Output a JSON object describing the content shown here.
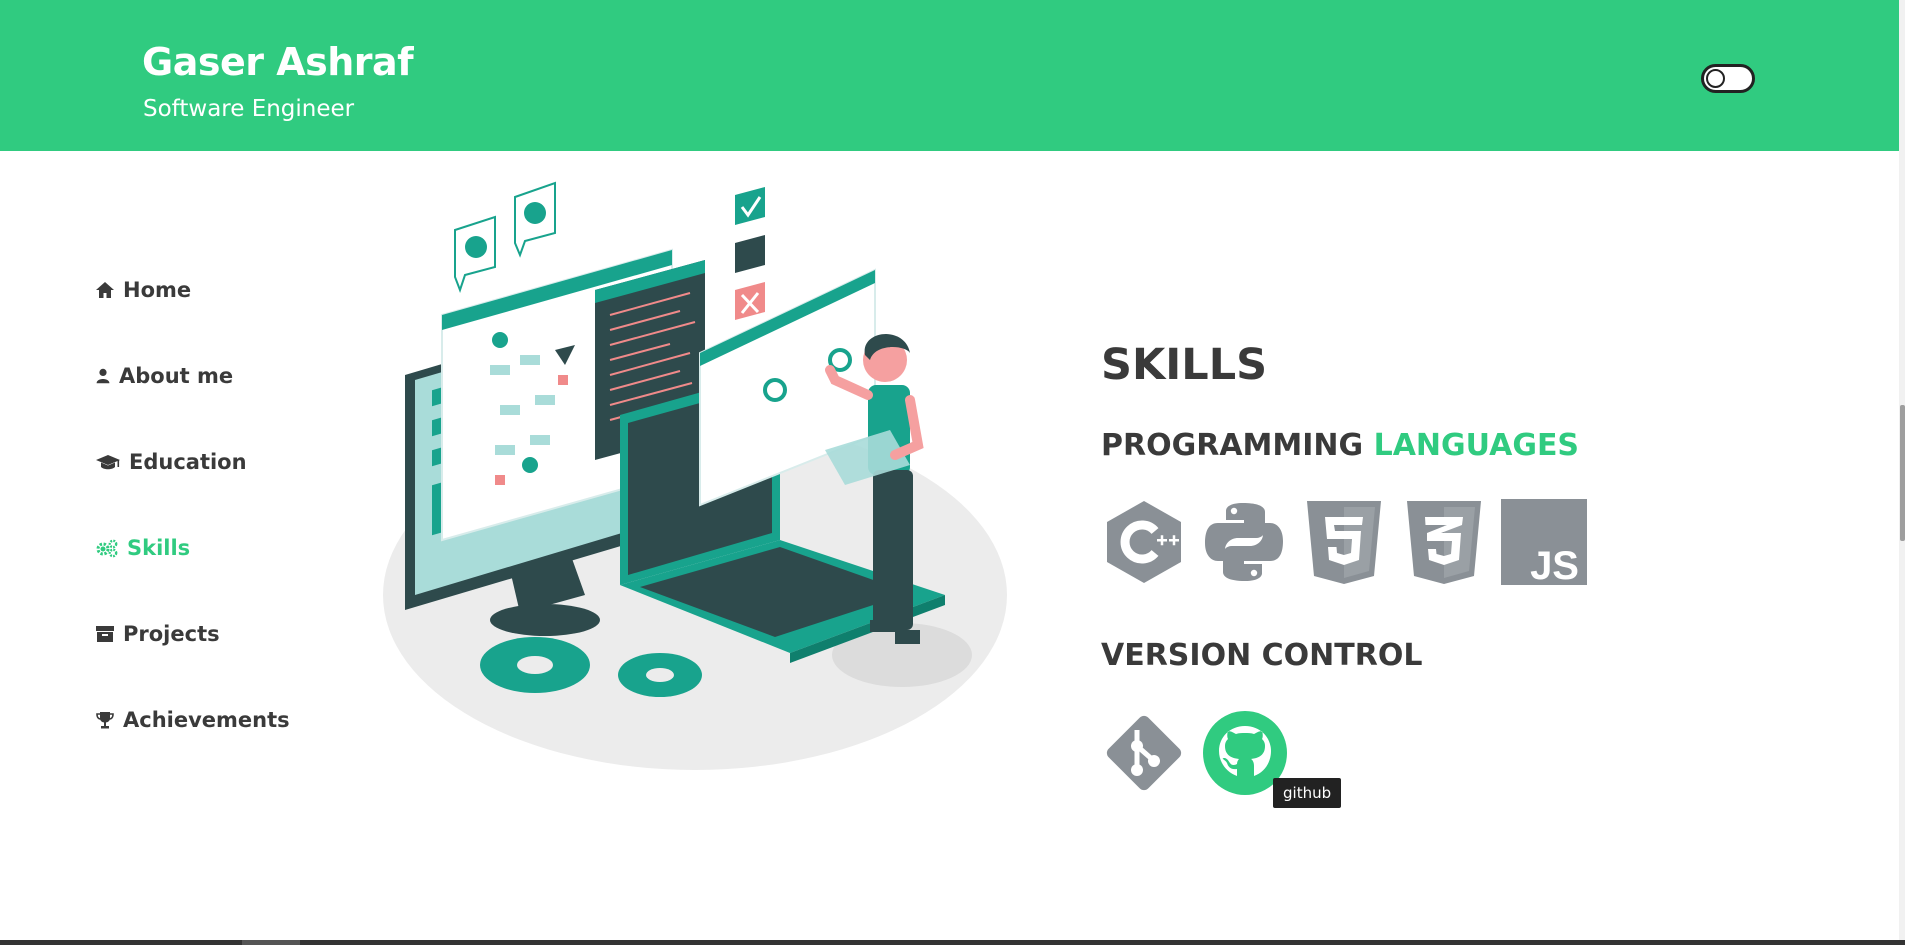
{
  "header": {
    "name": "Gaser Ashraf",
    "role": "Software Engineer",
    "toggle_icon": "theme-toggle-switch",
    "colors": {
      "accent": "#30cb80",
      "text": "#3a3a3a",
      "icon_gray": "#8a9096"
    }
  },
  "nav": {
    "items": [
      {
        "label": "Home",
        "icon": "home-icon"
      },
      {
        "label": "About me",
        "icon": "user-icon"
      },
      {
        "label": "Education",
        "icon": "graduation-cap-icon"
      },
      {
        "label": "Skills",
        "icon": "gears-icon",
        "active": true
      },
      {
        "label": "Projects",
        "icon": "archive-box-icon"
      },
      {
        "label": "Achievements",
        "icon": "trophy-icon"
      }
    ]
  },
  "skills": {
    "title": "SKILLS",
    "programming": {
      "title_part1": "PROGRAMMING",
      "title_part2": "LANGUAGES",
      "icons": [
        "cplusplus-icon",
        "python-icon",
        "html5-icon",
        "css3-icon",
        "javascript-icon"
      ]
    },
    "version_control": {
      "title": "VERSION CONTROL",
      "icons": [
        "git-icon",
        "github-icon"
      ]
    },
    "tooltip": "github"
  }
}
